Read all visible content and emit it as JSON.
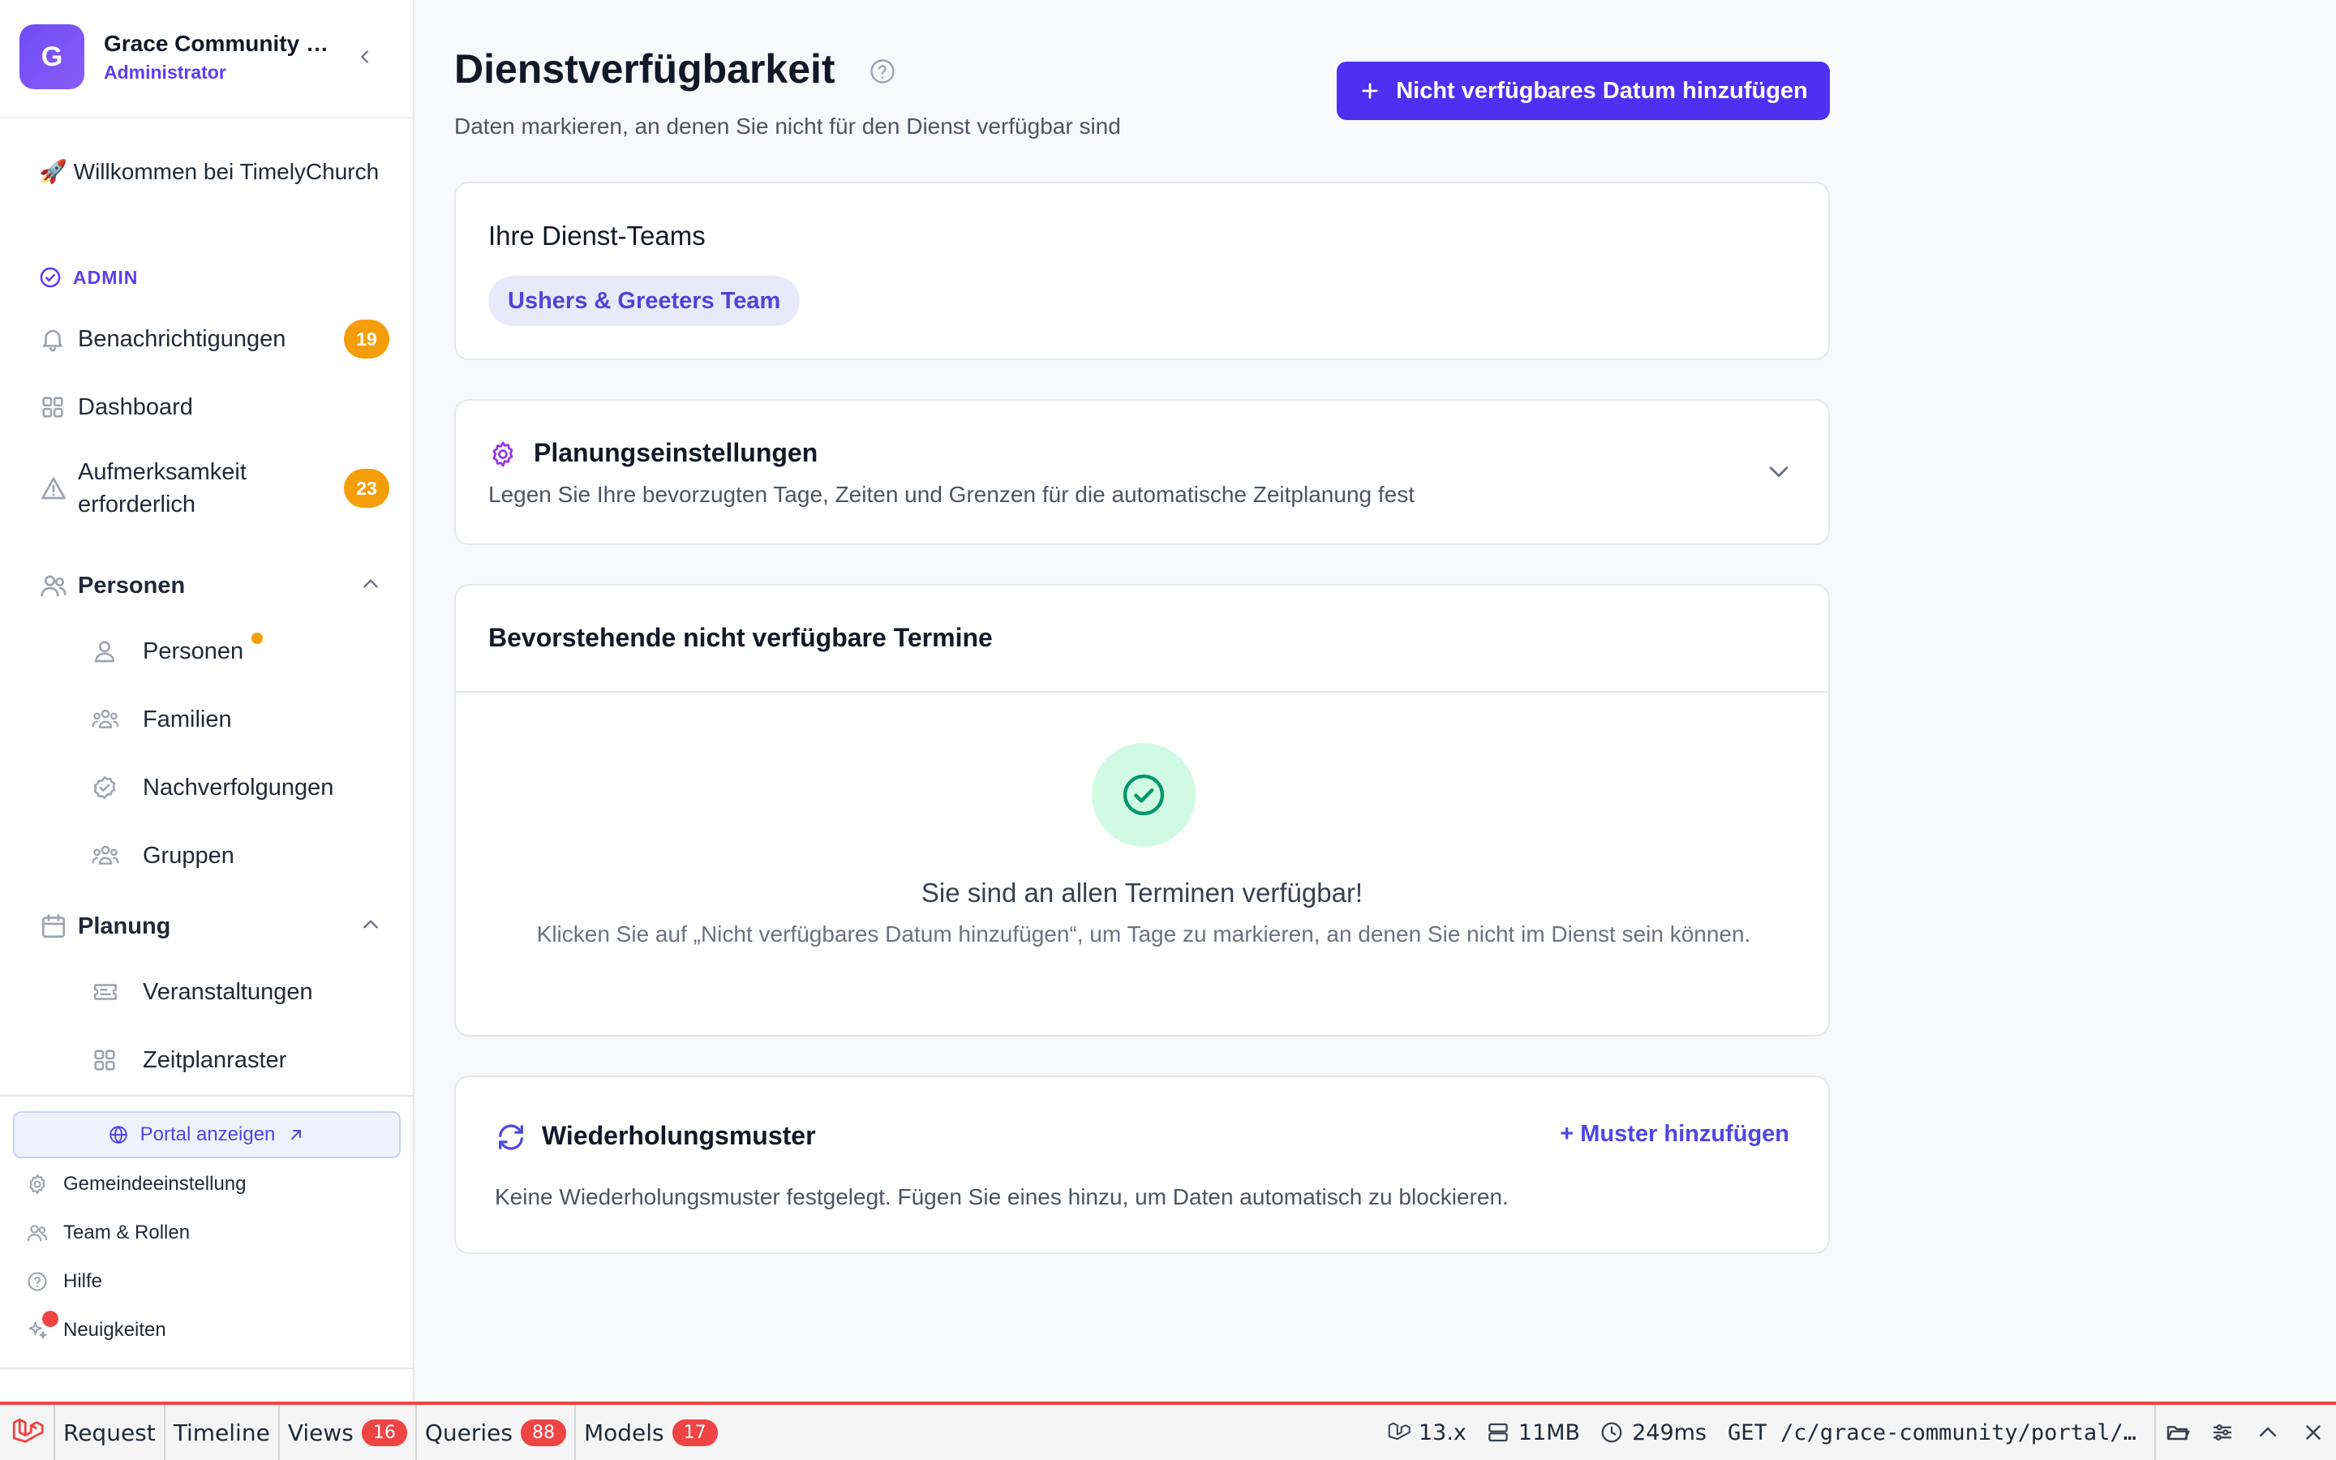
{
  "org": {
    "avatar_letter": "G",
    "name": "Grace Community Church",
    "role": "Administrator"
  },
  "sidebar": {
    "welcome_emoji": "🚀",
    "welcome": "Willkommen bei TimelyChurch",
    "admin_label": "ADMIN",
    "items": [
      {
        "label": "Benachrichtigungen",
        "badge": "19"
      },
      {
        "label": "Dashboard"
      },
      {
        "label": "Aufmerksamkeit erforderlich",
        "badge": "23"
      }
    ],
    "sections": [
      {
        "label": "Personen",
        "children": [
          "Personen",
          "Familien",
          "Nachverfolgungen",
          "Gruppen"
        ]
      },
      {
        "label": "Planung",
        "children": [
          "Veranstaltungen",
          "Zeitplanraster"
        ]
      }
    ],
    "portal_button": "Portal anzeigen",
    "footer": [
      "Gemeindeeinstellung",
      "Team & Rollen",
      "Hilfe",
      "Neuigkeiten"
    ]
  },
  "main": {
    "title": "Dienstverfügbarkeit",
    "subtitle": "Daten markieren, an denen Sie nicht für den Dienst verfügbar sind",
    "add_button": "Nicht verfügbares Datum hinzufügen",
    "teams_card": {
      "title": "Ihre Dienst-Teams",
      "teams": [
        "Ushers & Greeters Team"
      ]
    },
    "planning_card": {
      "title": "Planungseinstellungen",
      "description": "Legen Sie Ihre bevorzugten Tage, Zeiten und Grenzen für die automatische Zeitplanung fest"
    },
    "upcoming_card": {
      "title": "Bevorstehende nicht verfügbare Termine",
      "empty_title": "Sie sind an allen Terminen verfügbar!",
      "empty_description": "Klicken Sie auf „Nicht verfügbares Datum hinzufügen“, um Tage zu markieren, an denen Sie nicht im Dienst sein können."
    },
    "recurring_card": {
      "title": "Wiederholungsmuster",
      "add_link": "+ Muster hinzufügen",
      "description": "Keine Wiederholungsmuster festgelegt. Fügen Sie eines hinzu, um Daten automatisch zu blockieren."
    }
  },
  "debugbar": {
    "tabs": [
      {
        "label": "Request"
      },
      {
        "label": "Timeline"
      },
      {
        "label": "Views",
        "count": "16"
      },
      {
        "label": "Queries",
        "count": "88"
      },
      {
        "label": "Models",
        "count": "17"
      }
    ],
    "version": "13.x",
    "memory": "11MB",
    "time": "249ms",
    "request": "GET /c/grace-community/portal/serve/availability"
  },
  "colors": {
    "accent": "#4f2ff0",
    "badge": "#f59e0b",
    "success": "#16a34a",
    "debug_red": "#ef4444"
  }
}
